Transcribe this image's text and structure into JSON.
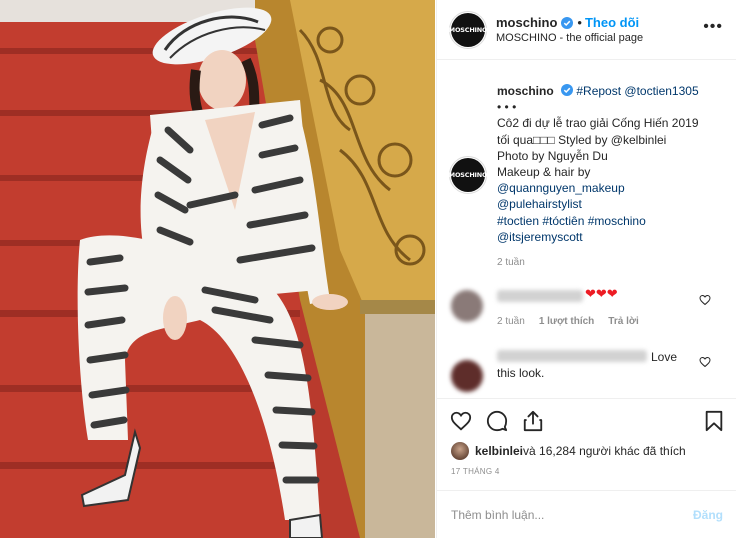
{
  "post": {
    "account": {
      "username": "moschino",
      "avatar_text": "MOSCHINO",
      "subtitle": "MOSCHINO - the official page",
      "follow_label": "Theo dõi",
      "more_label": "•••"
    },
    "caption": {
      "username": "moschino",
      "lines": [
        "#Repost @toctien1305",
        "• • •",
        "Cô2 đi dự lễ trao giải Cống Hiến 2019",
        "tối qua□□□ Styled by @kelbinlei",
        "Photo by Nguyễn Du",
        "Makeup & hair by",
        "@quannguyen_makeup",
        "@pulehairstylist",
        "#toctien #tóctiên #moschino",
        "@itsjeremyscott"
      ],
      "time": "2 tuần"
    },
    "comments": [
      {
        "hearts": "❤❤❤",
        "time": "2 tuần",
        "likes": "1 lượt thích",
        "reply": "Trả lời"
      },
      {
        "text_tail": "Love",
        "text_line2": "this look."
      }
    ],
    "likes": {
      "user": "kelbinlei",
      "text": " và 16,284 người khác đã thích"
    },
    "date": "17 THÁNG 4",
    "add_comment": {
      "placeholder": "Thêm bình luận...",
      "post_label": "Đăng"
    }
  },
  "icons": {
    "verified": "verified-badge-icon",
    "like": "heart-icon",
    "comment": "comment-bubble-icon",
    "share": "share-icon",
    "save": "bookmark-icon"
  },
  "colors": {
    "link": "#00376b",
    "follow": "#0095f6",
    "post_disabled": "#b2dffc",
    "meta": "#8e8e8e"
  }
}
